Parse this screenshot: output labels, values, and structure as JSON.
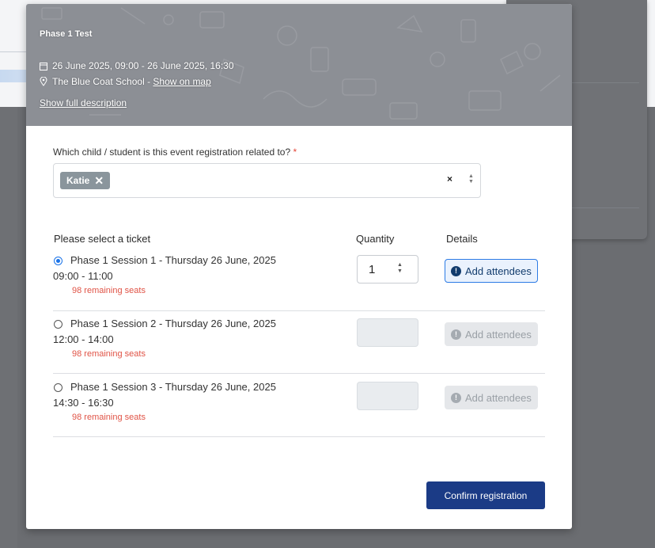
{
  "event": {
    "title": "Phase 1 Test",
    "date_range": "26 June 2025, 09:00 - 26 June 2025, 16:30",
    "location": "The Blue Coat School - ",
    "map_link": "Show on map",
    "description_link": "Show full description"
  },
  "question": {
    "label": "Which child / student is this event registration related to?",
    "required_mark": "*",
    "selected_chip": "Katie",
    "chip_remove": "✕",
    "clear": "×"
  },
  "table": {
    "headers": [
      "Please select a ticket",
      "Quantity",
      "Details"
    ],
    "rows": [
      {
        "name": "Phase 1 Session 1 - Thursday 26 June, 2025",
        "time": "09:00 - 11:00",
        "seats": "98 remaining seats",
        "selected": true,
        "quantity": "1",
        "details": "Add attendees"
      },
      {
        "name": "Phase 1 Session 2 - Thursday 26 June, 2025",
        "time": "12:00 - 14:00",
        "seats": "98 remaining seats",
        "selected": false,
        "quantity": "",
        "details": "Add attendees"
      },
      {
        "name": "Phase 1 Session 3 - Thursday 26 June, 2025",
        "time": "14:30 - 16:30",
        "seats": "98 remaining seats",
        "selected": false,
        "quantity": "",
        "details": "Add attendees"
      }
    ]
  },
  "confirm_label": "Confirm registration",
  "colors": {
    "primary": "#1b3b86",
    "seats_text": "#e05346",
    "chip": "#8a959c",
    "radio_selected": "#1a73e8"
  },
  "icons": {
    "calendar": "calendar-icon",
    "location": "location-pin-icon",
    "info": "info-icon",
    "remove": "close-icon",
    "stepper": "stepper-arrows-icon"
  }
}
